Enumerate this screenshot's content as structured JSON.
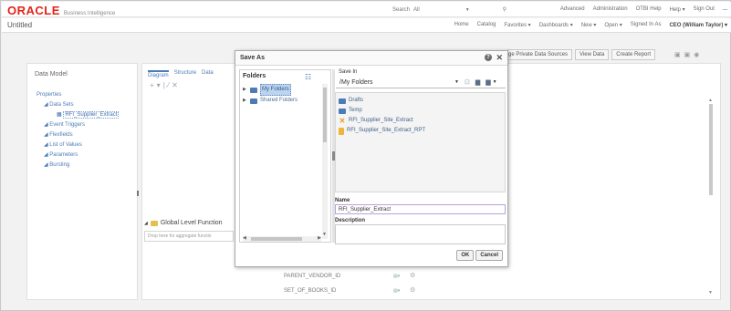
{
  "header": {
    "brand": "ORACLE",
    "product": "Business Intelligence",
    "search_label": "Search",
    "search_scope": "All",
    "links": [
      "Advanced",
      "Administration",
      "OTBI Help",
      "Help ▾",
      "Sign Out",
      "..."
    ]
  },
  "secondary": {
    "title": "Untitled",
    "links": [
      "Home",
      "Catalog",
      "Favorites ▾",
      "Dashboards ▾",
      "New ▾",
      "Open ▾"
    ],
    "signed_in_prefix": "Signed In As",
    "signed_in_user": "CEO (William Taylor) ▾"
  },
  "toolbar": {
    "manage_private_label": "ge Private Data Sources",
    "view_data_label": "View Data",
    "create_report_label": "Create Report"
  },
  "left_panel": {
    "title": "Data Model",
    "properties": "Properties",
    "data_sets": "Data Sets",
    "data_set_item": "RFI_Supplier_Extract",
    "items": [
      "Event Triggers",
      "Flexfields",
      "List of Values",
      "Parameters",
      "Bursting"
    ]
  },
  "main": {
    "tabs": [
      "Diagram",
      "Structure",
      "Data"
    ],
    "global_level_label": "Global Level Function",
    "drop_hint": "Drop here for aggregate functio",
    "columns": [
      "PARENT_VENDOR_ID",
      "SET_OF_BOOKS_ID"
    ]
  },
  "dialog": {
    "title": "Save As",
    "folders_label": "Folders",
    "folder_tree": [
      {
        "label": "My Folders",
        "selected": true
      },
      {
        "label": "Shared Folders",
        "selected": false
      }
    ],
    "save_in_label": "Save In",
    "save_in_value": "/My Folders",
    "files": [
      {
        "label": "Drafts",
        "kind": "folder"
      },
      {
        "label": "Temp",
        "kind": "folder"
      },
      {
        "label": "RFI_Supplier_Site_Extract",
        "kind": "datamodel"
      },
      {
        "label": "RFI_Supplier_Site_Extract_RPT",
        "kind": "report"
      }
    ],
    "name_label": "Name",
    "name_value": "RFI_Supplier_Extract",
    "description_label": "Description",
    "ok_label": "OK",
    "cancel_label": "Cancel"
  },
  "colors": {
    "brand_red": "#e2231a",
    "link_blue": "#4b7cb8",
    "selection_bg": "#bcd4ee"
  }
}
